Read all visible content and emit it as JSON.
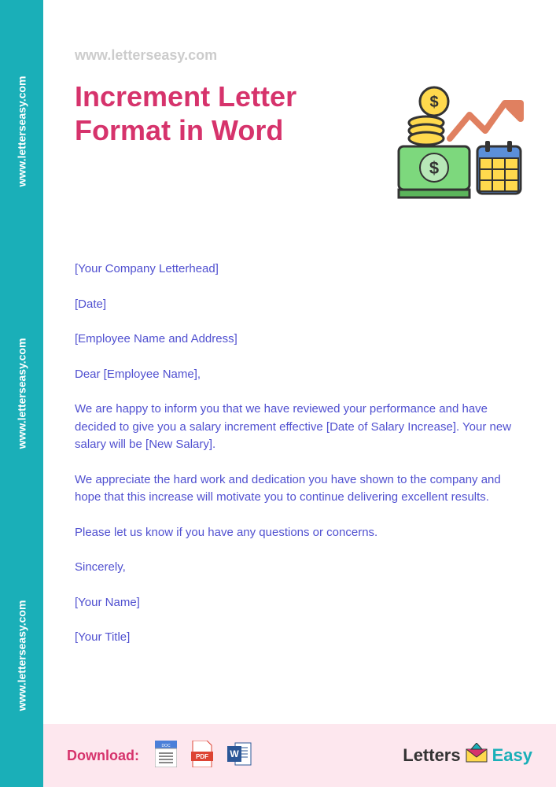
{
  "sidebar": {
    "watermark": "www.letterseasy.com"
  },
  "header": {
    "website_url": "www.letterseasy.com",
    "title": "Increment Letter Format in Word"
  },
  "letter": {
    "letterhead": "[Your Company Letterhead]",
    "date": "[Date]",
    "employee_name_address": "[Employee Name and Address]",
    "salutation": "Dear [Employee Name],",
    "para1": "We are happy to inform you that we have reviewed your performance and have decided to give you a salary increment effective [Date of Salary Increase]. Your new salary will be [New Salary].",
    "para2": "We appreciate the hard work and dedication you have shown to the company and hope that this increase will motivate you to continue delivering excellent results.",
    "para3": "Please let us know if you have any questions or concerns.",
    "closing": "Sincerely,",
    "your_name": "[Your Name]",
    "your_title": "[Your Title]"
  },
  "footer": {
    "download_label": "Download:",
    "logo_part1": "Letters",
    "logo_part2": "Easy"
  }
}
